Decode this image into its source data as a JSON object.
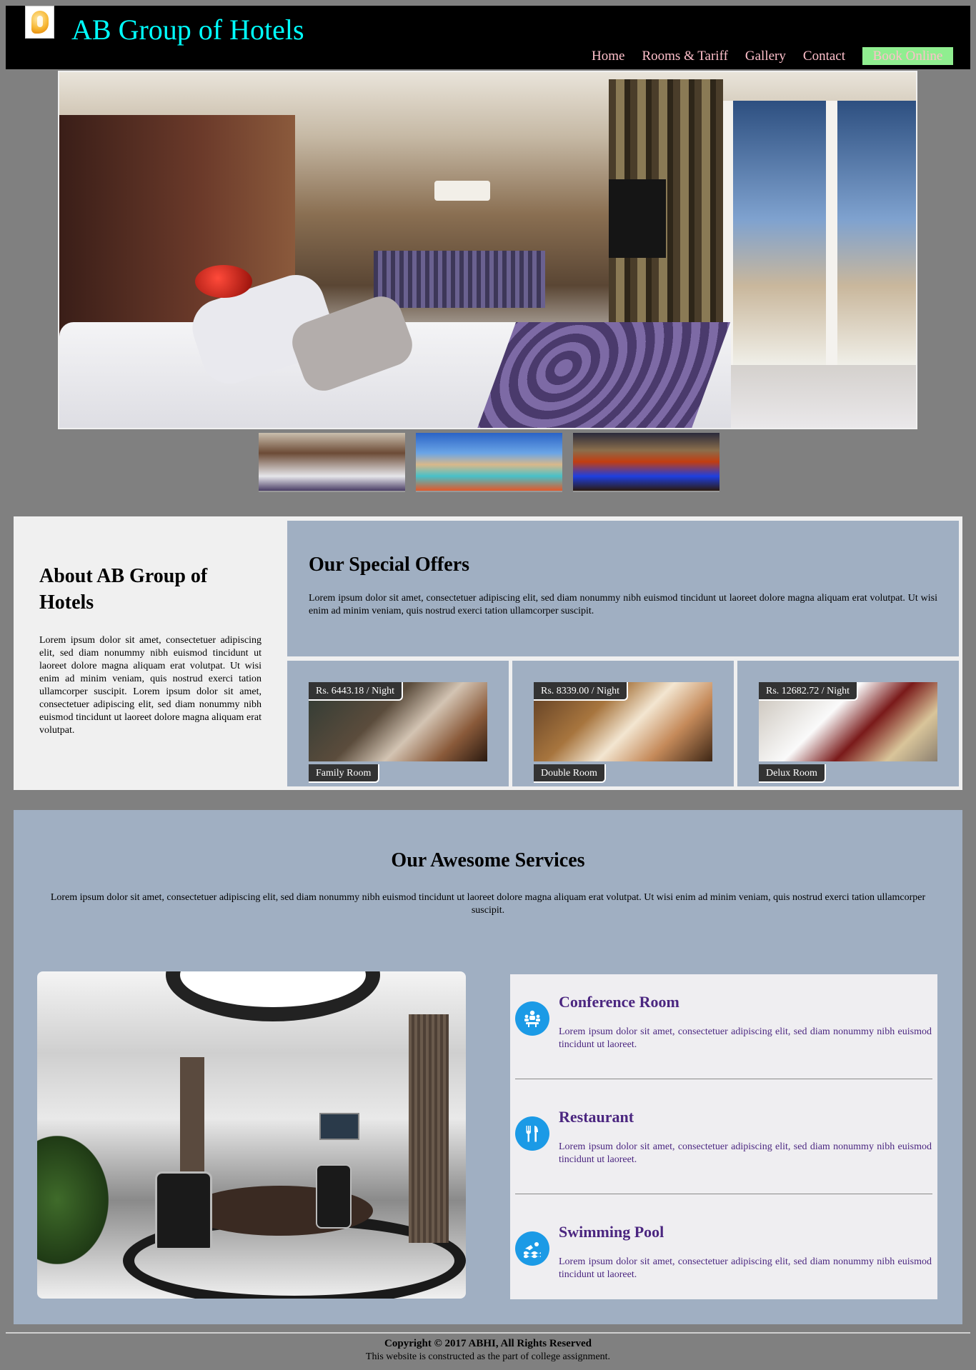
{
  "header": {
    "title": "AB Group of Hotels",
    "nav": [
      "Home",
      "Rooms & Tariff",
      "Gallery",
      "Contact"
    ],
    "book_label": "Book Online"
  },
  "about": {
    "title": "About AB Group of Hotels",
    "text": "Lorem ipsum dolor sit amet, consectetuer adipiscing elit, sed diam nonummy nibh euismod tincidunt ut laoreet dolore magna aliquam erat volutpat. Ut wisi enim ad minim veniam, quis nostrud exerci tation ullamcorper suscipit. Lorem ipsum dolor sit amet, consectetuer adipiscing elit, sed diam nonummy nibh euismod tincidunt ut laoreet dolore magna aliquam erat volutpat."
  },
  "offers": {
    "title": "Our Special Offers",
    "text": "Lorem ipsum dolor sit amet, consectetuer adipiscing elit, sed diam nonummy nibh euismod tincidunt ut laoreet dolore magna aliquam erat volutpat. Ut wisi enim ad minim veniam, quis nostrud exerci tation ullamcorper suscipit.",
    "rooms": [
      {
        "price": "Rs. 6443.18 / Night",
        "name": "Family Room"
      },
      {
        "price": "Rs. 8339.00 / Night",
        "name": "Double Room"
      },
      {
        "price": "Rs. 12682.72 / Night",
        "name": "Delux Room"
      }
    ]
  },
  "services": {
    "title": "Our Awesome Services",
    "intro": "Lorem ipsum dolor sit amet, consectetuer adipiscing elit, sed diam nonummy nibh euismod tincidunt ut laoreet dolore magna aliquam erat volutpat. Ut wisi enim ad minim veniam, quis nostrud exerci tation ullamcorper suscipit.",
    "items": [
      {
        "title": "Conference Room",
        "text": "Lorem ipsum dolor sit amet, consectetuer adipiscing elit, sed diam nonummy nibh euismod tincidunt ut laoreet.",
        "icon": "conference-icon"
      },
      {
        "title": "Restaurant",
        "text": "Lorem ipsum dolor sit amet, consectetuer adipiscing elit, sed diam nonummy nibh euismod tincidunt ut laoreet.",
        "icon": "fork-knife-icon"
      },
      {
        "title": "Swimming Pool",
        "text": "Lorem ipsum dolor sit amet, consectetuer adipiscing elit, sed diam nonummy nibh euismod tincidunt ut laoreet.",
        "icon": "swimmer-icon"
      }
    ]
  },
  "footer": {
    "copyright": "Copyright © 2017 ABHI, All Rights Reserved",
    "note": "This website is constructed as the part of college assignment."
  },
  "colors": {
    "header_bg": "#000000",
    "title": "#00ffff",
    "nav": "#ffc0cb",
    "book_bg": "#90ee90",
    "panel": "#a0afc2",
    "service_text": "#4b2680",
    "icon_bg": "#1b9ae6"
  }
}
